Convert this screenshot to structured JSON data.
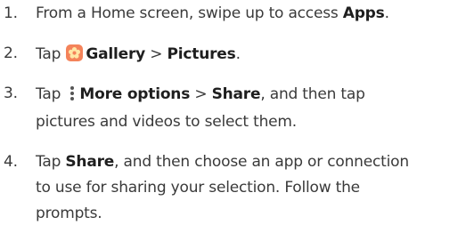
{
  "steps": [
    {
      "number": "1.",
      "line1": {
        "text_before": "From a Home screen, swipe up to access ",
        "bold": "Apps",
        "text_after": "."
      }
    },
    {
      "number": "2.",
      "line1": {
        "text_before": "Tap ",
        "icon": "gallery-icon",
        "bold1": "Gallery",
        "separator": " > ",
        "bold2": "Pictures",
        "text_after": "."
      }
    },
    {
      "number": "3.",
      "line1": {
        "text_before": "Tap ",
        "icon": "more-options-icon",
        "bold1": "More options",
        "separator": " > ",
        "bold2": "Share",
        "text_after": ", and then tap"
      },
      "line2": "pictures and videos to select them."
    },
    {
      "number": "4.",
      "line1": {
        "text_before": "Tap ",
        "bold": "Share",
        "text_after": ", and then choose an app or connection"
      },
      "line2": "to use for sharing your selection. Follow the",
      "line3": "prompts."
    }
  ],
  "colors": {
    "text": "#3a3a3a",
    "bold_text": "#1f1f1f",
    "gallery_icon_bg": "#f4835a"
  }
}
